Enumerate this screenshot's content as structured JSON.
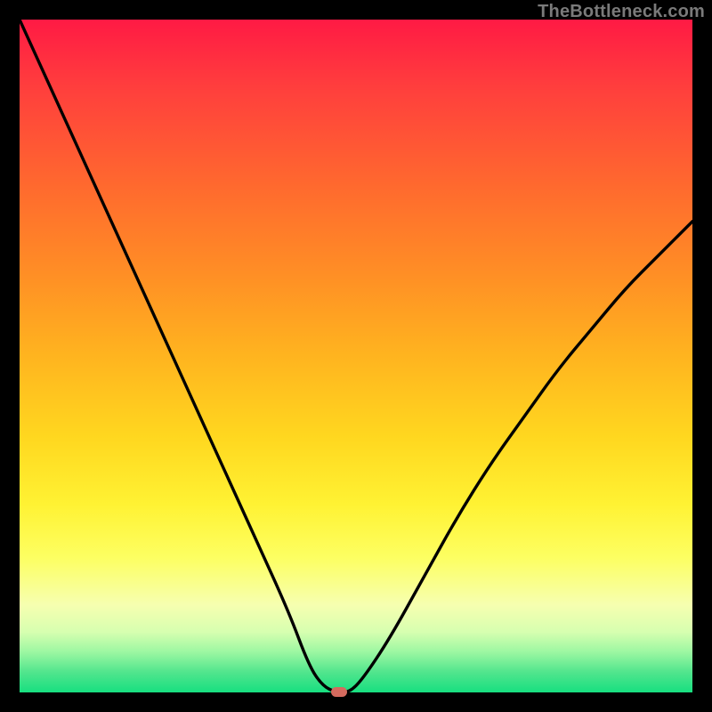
{
  "watermark": {
    "text": "TheBottleneck.com"
  },
  "colors": {
    "curve_stroke": "#000000",
    "marker_fill": "#d46a5e",
    "frame_bg": "#000000"
  },
  "chart_data": {
    "type": "line",
    "title": "",
    "xlabel": "",
    "ylabel": "",
    "xlim": [
      0,
      100
    ],
    "ylim": [
      0,
      100
    ],
    "grid": false,
    "legend": false,
    "series": [
      {
        "name": "bottleneck-curve",
        "x": [
          0,
          5,
          10,
          15,
          20,
          25,
          30,
          35,
          40,
          43,
          45,
          47,
          49,
          51,
          55,
          60,
          65,
          70,
          75,
          80,
          85,
          90,
          95,
          100
        ],
        "y": [
          100,
          89,
          78,
          67,
          56,
          45,
          34,
          23,
          12,
          4,
          1,
          0,
          0,
          2,
          8,
          17,
          26,
          34,
          41,
          48,
          54,
          60,
          65,
          70
        ]
      }
    ],
    "marker": {
      "x": 47.5,
      "y": 0,
      "color": "#d46a5e"
    },
    "gradient_stops": [
      {
        "pos": 0.0,
        "color": "#ff1a44"
      },
      {
        "pos": 0.25,
        "color": "#ff6a2e"
      },
      {
        "pos": 0.5,
        "color": "#ffb41f"
      },
      {
        "pos": 0.72,
        "color": "#fff233"
      },
      {
        "pos": 0.87,
        "color": "#f6ffb0"
      },
      {
        "pos": 0.97,
        "color": "#51e58d"
      },
      {
        "pos": 1.0,
        "color": "#17df80"
      }
    ]
  }
}
